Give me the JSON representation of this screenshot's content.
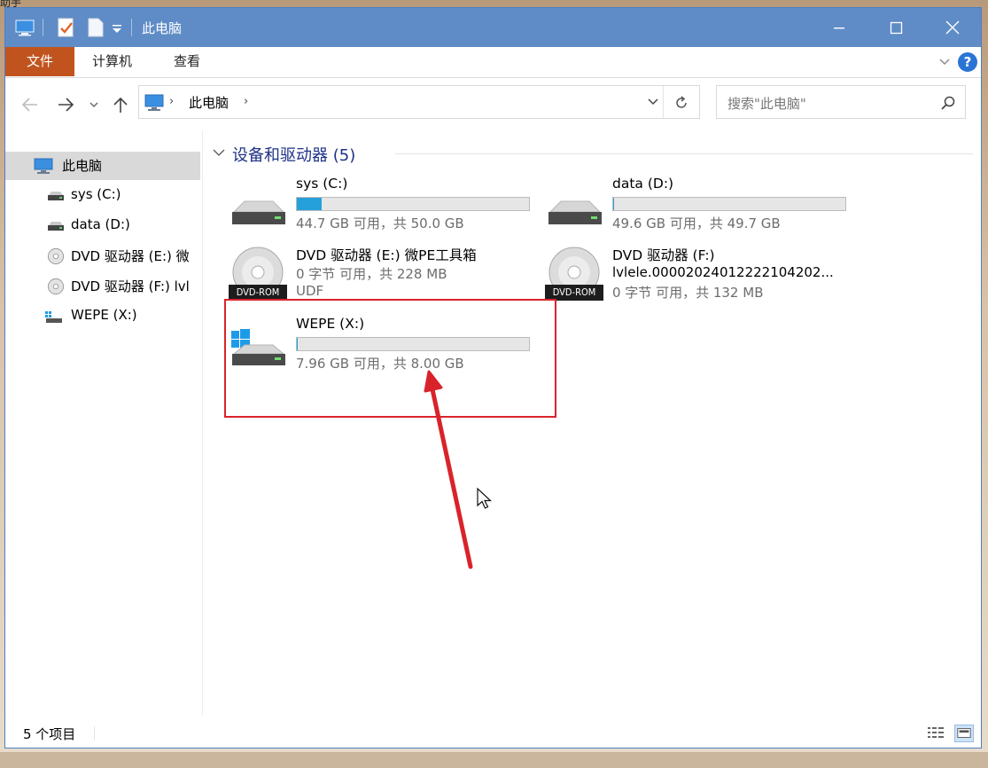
{
  "desktop": {
    "corner_text": "助手"
  },
  "window": {
    "title": "此电脑",
    "controls": {
      "minimize": "—",
      "maximize": "☐",
      "close": "✕"
    }
  },
  "ribbon": {
    "tabs": [
      "文件",
      "计算机",
      "查看"
    ],
    "help": "?"
  },
  "address": {
    "crumb": "此电脑",
    "search_placeholder": "搜索\"此电脑\""
  },
  "nav_pane": {
    "items": [
      {
        "label": "此电脑",
        "icon": "computer-icon",
        "selected": true
      },
      {
        "label": "sys (C:)",
        "icon": "drive-icon"
      },
      {
        "label": "data (D:)",
        "icon": "drive-icon"
      },
      {
        "label": "DVD 驱动器 (E:) 微",
        "icon": "dvd-icon"
      },
      {
        "label": "DVD 驱动器 (F:) lvl",
        "icon": "dvd-icon"
      },
      {
        "label": "WEPE (X:)",
        "icon": "usb-drive-icon"
      }
    ]
  },
  "group": {
    "title": "设备和驱动器 (5)"
  },
  "drives": {
    "c": {
      "name": "sys (C:)",
      "info": "44.7 GB 可用，共 50.0 GB",
      "used_fraction": 0.106
    },
    "d": {
      "name": "data (D:)",
      "info": "49.6 GB 可用，共 49.7 GB",
      "used_fraction": 0.002
    },
    "e": {
      "name": "DVD 驱动器 (E:) 微PE工具箱",
      "line2": "0 字节 可用，共 228 MB",
      "line3": "UDF",
      "badge": "DVD-ROM"
    },
    "f": {
      "name": "DVD 驱动器 (F:)",
      "line2": "lvlele.00002024012222104202...",
      "line3": "0 字节 可用，共 132 MB",
      "badge": "DVD-ROM"
    },
    "x": {
      "name": "WEPE (X:)",
      "info": "7.96 GB 可用，共 8.00 GB",
      "used_fraction": 0.005
    }
  },
  "status": {
    "item_count": "5 个项目"
  },
  "colors": {
    "titlebar": "#5f8cc6",
    "file_tab": "#c1541e",
    "usage_bar": "#26a0da",
    "annotation": "#d9232b",
    "group_title": "#1e3287"
  }
}
